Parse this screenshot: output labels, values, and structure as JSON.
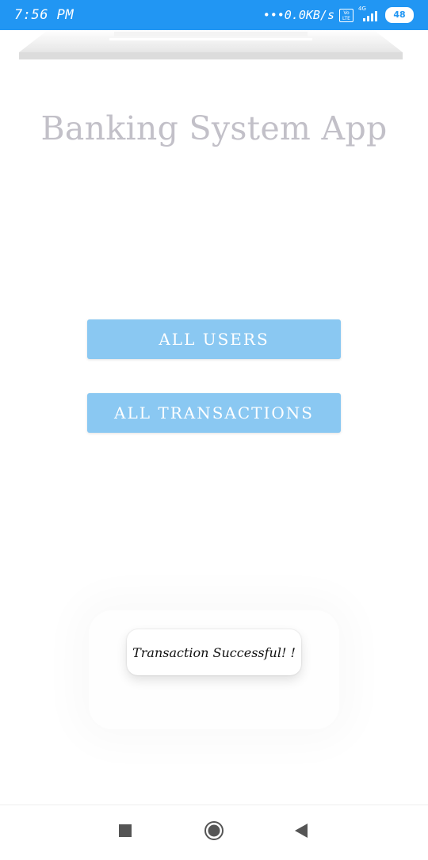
{
  "status_bar": {
    "time": "7:56 PM",
    "network_speed": "•••0.0KB/s",
    "volte_label": "Vo LTE",
    "network_type": "4G",
    "battery": "48"
  },
  "app": {
    "title": "Banking System App"
  },
  "buttons": {
    "all_users": "ALL USERS",
    "all_transactions": "ALL TRANSACTIONS"
  },
  "toast": {
    "message": "Transaction Successful! !"
  },
  "nav": {
    "icons": [
      "recents-square-icon",
      "home-circle-icon",
      "back-triangle-icon"
    ]
  },
  "colors": {
    "status_bar": "#2196f3",
    "button": "#8ac8f2",
    "title": "#c2c0c8"
  }
}
